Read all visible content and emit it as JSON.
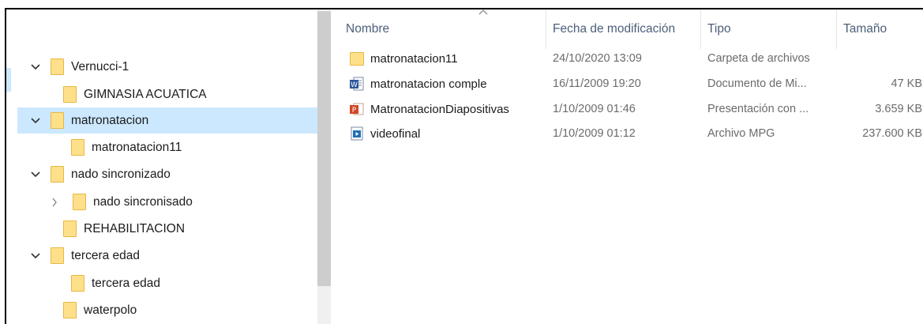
{
  "colors": {
    "selection": "#cce8ff",
    "folder_fill": "#ffe08a",
    "folder_edge": "#e6b845",
    "header_text": "#4c607a",
    "muted_text": "#6b6b6b",
    "word_blue": "#2b579a",
    "ppt_red": "#d24726",
    "video_blue": "#1f6fb5"
  },
  "nav_tree": [
    {
      "label": "Vernucci-1",
      "chevron": "expanded",
      "icon": "folder-icon"
    },
    {
      "label": "GIMNASIA ACUATICA",
      "chevron": "none",
      "icon": "folder-icon"
    },
    {
      "label": "matronatacion",
      "chevron": "expanded",
      "icon": "folder-icon",
      "selected": true
    },
    {
      "label": "matronatacion11",
      "chevron": "none",
      "icon": "folder-icon"
    },
    {
      "label": "nado sincronizado",
      "chevron": "expanded",
      "icon": "folder-icon"
    },
    {
      "label": "nado sincronisado",
      "chevron": "collapsed",
      "icon": "folder-icon"
    },
    {
      "label": "REHABILITACION",
      "chevron": "none",
      "icon": "folder-icon"
    },
    {
      "label": "tercera edad",
      "chevron": "expanded",
      "icon": "folder-icon"
    },
    {
      "label": "tercera edad",
      "chevron": "none",
      "icon": "folder-icon"
    },
    {
      "label": "waterpolo",
      "chevron": "none",
      "icon": "folder-icon"
    }
  ],
  "columns": {
    "name": "Nombre",
    "modified": "Fecha de modificación",
    "type": "Tipo",
    "size": "Tamaño"
  },
  "files": [
    {
      "name": "matronatacion11",
      "modified": "24/10/2020 13:09",
      "type": "Carpeta de archivos",
      "size": "",
      "icon": "folder-icon"
    },
    {
      "name": "matronatacion comple",
      "modified": "16/11/2009 19:20",
      "type": "Documento de Mi...",
      "size": "47 KB",
      "icon": "word-document-icon"
    },
    {
      "name": "MatronatacionDiapositivas",
      "modified": "1/10/2009 01:46",
      "type": "Presentación con ...",
      "size": "3.659 KB",
      "icon": "powerpoint-slideshow-icon"
    },
    {
      "name": "videofinal",
      "modified": "1/10/2009 01:12",
      "type": "Archivo MPG",
      "size": "237.600 KB",
      "icon": "video-file-icon"
    }
  ]
}
